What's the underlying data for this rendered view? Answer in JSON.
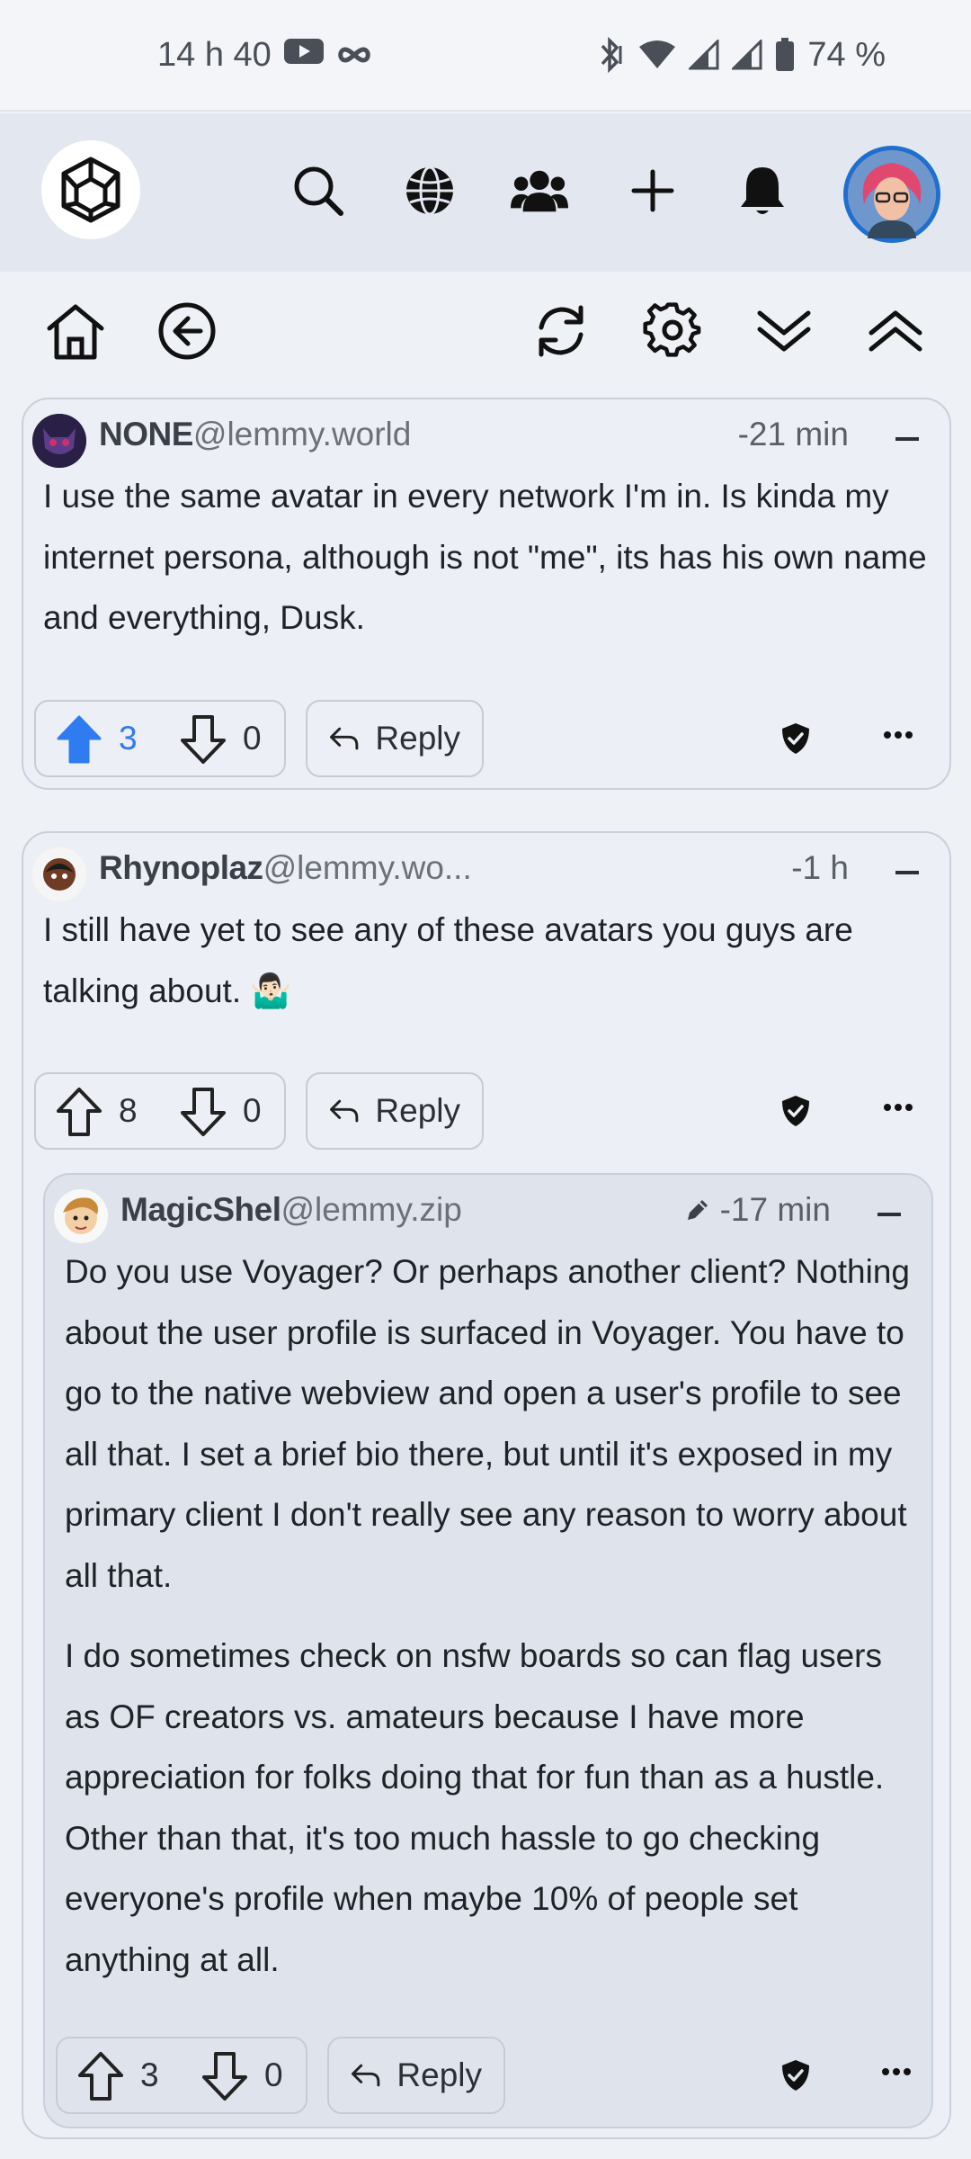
{
  "status_bar": {
    "time": "14 h 40",
    "battery": "74 %"
  },
  "nav": {
    "icons": [
      "lemmy-logo-icon",
      "search-icon",
      "globe-icon",
      "community-icon",
      "plus-icon",
      "bell-icon",
      "profile-avatar"
    ]
  },
  "toolbar": {
    "icons": [
      "home-icon",
      "back-icon",
      "refresh-icon",
      "settings-icon",
      "collapse-all-icon",
      "expand-all-icon"
    ]
  },
  "comments": [
    {
      "username": "NONE",
      "instance": "@lemmy.world",
      "time": "-21 min",
      "body": [
        "I use the same avatar in every network I'm in. Is kinda my internet persona, although is not \"me\", its has his own name and everything, Dusk."
      ],
      "upvotes": "3",
      "downvotes": "0",
      "upvoted": true,
      "reply_label": "Reply"
    },
    {
      "username": "Rhynoplaz",
      "instance": "@lemmy.wo...",
      "time": "-1 h",
      "body": [
        "I still have yet to see any of these avatars you guys are talking about. 🤷🏻‍♂️"
      ],
      "upvotes": "8",
      "downvotes": "0",
      "upvoted": false,
      "reply_label": "Reply"
    },
    {
      "username": "MagicShel",
      "instance": "@lemmy.zip",
      "time": "-17 min",
      "edited": true,
      "body": [
        "Do you use Voyager? Or perhaps another client? Nothing about the user profile is surfaced in Voyager. You have to go to the native webview and open a user's profile to see all that. I set a brief bio there, but until it's exposed in my primary client I don't really see any reason to worry about all that.",
        "I do sometimes check on nsfw boards so can flag users as OF creators vs. amateurs because I have more appreciation for folks doing that for fun than as a hustle. Other than that, it's too much hassle to go checking everyone's profile when maybe 10% of people set anything at all."
      ],
      "upvotes": "3",
      "downvotes": "0",
      "upvoted": false,
      "reply_label": "Reply"
    }
  ],
  "colors": {
    "accent": "#2f7bf0",
    "card_bg": "#eceff5",
    "nested_bg": "#dfe4ec"
  }
}
